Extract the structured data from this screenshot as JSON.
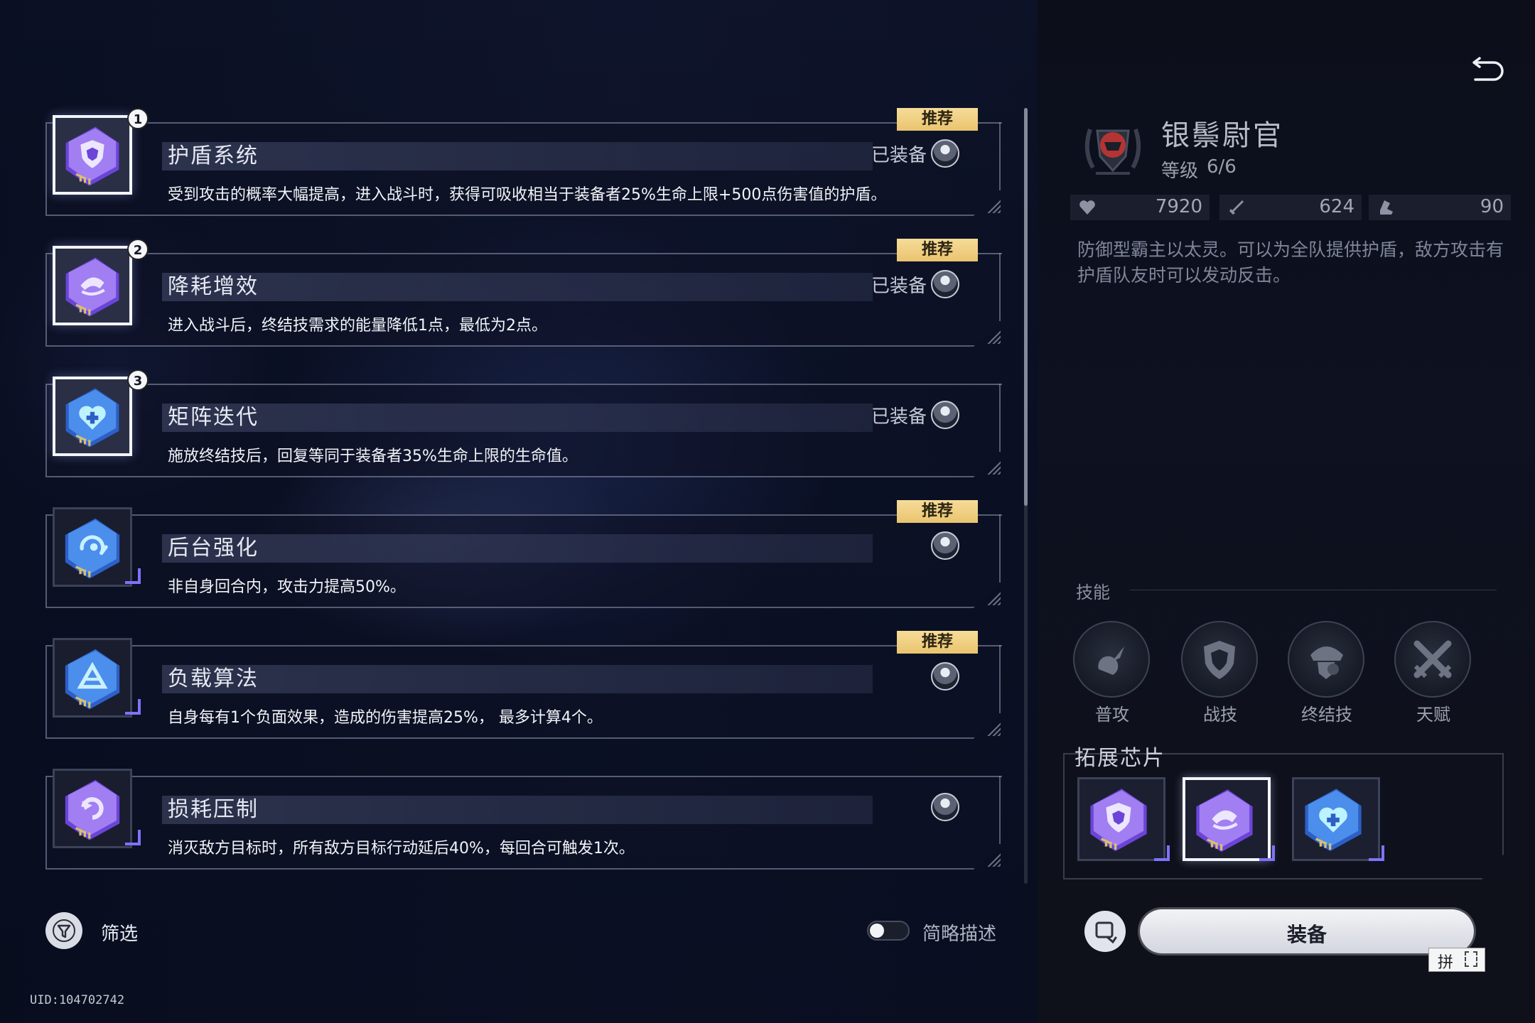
{
  "chips": [
    {
      "title": "护盾系统",
      "desc": "受到攻击的概率大幅提高，进入战斗时，获得可吸收相当于装备者25%生命上限+500点伤害值的护盾。",
      "recommended": "推荐",
      "equipped": "已装备",
      "order": "1",
      "color": "purple",
      "glyph": "shield"
    },
    {
      "title": "降耗增效",
      "desc": "进入战斗后，终结技需求的能量降低1点，最低为2点。",
      "recommended": "推荐",
      "equipped": "已装备",
      "order": "2",
      "color": "purple",
      "glyph": "hat"
    },
    {
      "title": "矩阵迭代",
      "desc": "施放终结技后，回复等同于装备者35%生命上限的生命值。",
      "recommended": "",
      "equipped": "已装备",
      "order": "3",
      "color": "blue",
      "glyph": "heart"
    },
    {
      "title": "后台强化",
      "desc": "非自身回合内，攻击力提高50%。",
      "recommended": "推荐",
      "equipped": "",
      "order": "",
      "color": "blue",
      "glyph": "swirl"
    },
    {
      "title": "负载算法",
      "desc": "自身每有1个负面效果，造成的伤害提高25%， 最多计算4个。",
      "recommended": "推荐",
      "equipped": "",
      "order": "",
      "color": "blue",
      "glyph": "triangle"
    },
    {
      "title": "损耗压制",
      "desc": "消灭敌方目标时，所有敌方目标行动延后40%，每回合可触发1次。",
      "recommended": "",
      "equipped": "",
      "order": "",
      "color": "purple",
      "glyph": "arrow"
    }
  ],
  "footer": {
    "filter_label": "筛选",
    "brief_label": "简略描述",
    "uid": "UID:104702742"
  },
  "character": {
    "name": "银鬃尉官",
    "level_label": "等级",
    "level_value": "6/6",
    "stats": {
      "hp": "7920",
      "atk": "624",
      "speed": "90"
    },
    "desc": "防御型霸主以太灵。可以为全队提供护盾，敌方攻击有护盾队友时可以发动反击。"
  },
  "skills": {
    "label": "技能",
    "items": [
      "普攻",
      "战技",
      "终结技",
      "天赋"
    ]
  },
  "extension": {
    "label": "拓展芯片"
  },
  "equip_button": "装备",
  "mini_widget_text": "拼",
  "colors": {
    "recommend": "#f0cf80",
    "purple_chip": "#8b6cf0",
    "blue_chip": "#3f7be6",
    "accent_corner": "#7e73ff"
  }
}
